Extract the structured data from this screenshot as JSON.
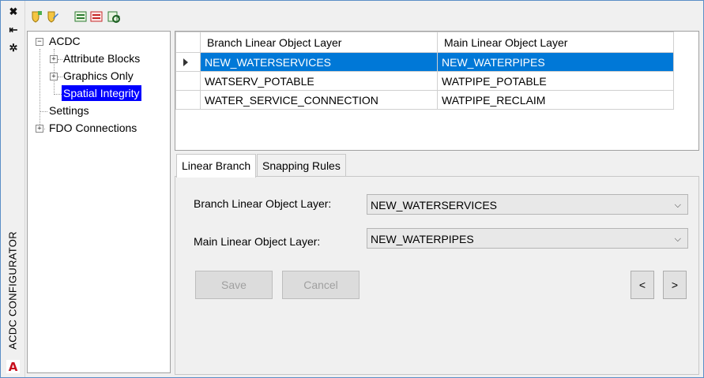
{
  "side_strip": {
    "title": "ACDC CONFIGURATOR",
    "buttons": [
      {
        "icon": "close-icon",
        "glyph": "✖"
      },
      {
        "icon": "pin-icon",
        "glyph": "⇤"
      },
      {
        "icon": "settings-icon",
        "glyph": "✲"
      }
    ],
    "app_logo_letter": "A"
  },
  "toolbar": {
    "buttons": [
      "shield-add-icon",
      "shield-edit-icon",
      "layer-add-icon",
      "layer-remove-icon",
      "layer-refresh-icon"
    ]
  },
  "tree": {
    "root": "ACDC",
    "children": [
      "Attribute Blocks",
      "Graphics Only",
      "Spatial Integrity"
    ],
    "selected": "Spatial Integrity",
    "other_nodes": [
      "Settings",
      "FDO Connections"
    ]
  },
  "grid": {
    "columns": [
      "Branch Linear Object Layer",
      "Main Linear Object Layer"
    ],
    "rows": [
      [
        "NEW_WATERSERVICES",
        "NEW_WATERPIPES"
      ],
      [
        "WATSERV_POTABLE",
        "WATPIPE_POTABLE"
      ],
      [
        "WATER_SERVICE_CONNECTION",
        "WATPIPE_RECLAIM"
      ]
    ],
    "selected_row": 0
  },
  "tabs": [
    {
      "label": "Linear Branch",
      "active": true
    },
    {
      "label": "Snapping Rules",
      "active": false
    }
  ],
  "form": {
    "branch_label": "Branch Linear Object Layer:",
    "branch_value": "NEW_WATERSERVICES",
    "main_label": "Main Linear Object Layer:",
    "main_value": "NEW_WATERPIPES",
    "save_label": "Save",
    "cancel_label": "Cancel",
    "prev_label": "<",
    "next_label": ">"
  },
  "colors": {
    "tree_selection": "#0000ff",
    "grid_selection": "#0078d7",
    "frame_border": "#5b8fc7",
    "logo_red": "#c8101e"
  }
}
